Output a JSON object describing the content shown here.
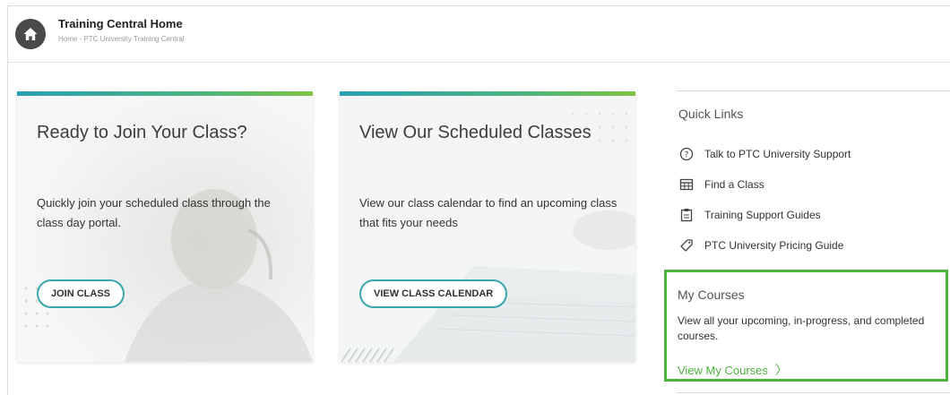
{
  "header": {
    "title": "Training Central Home",
    "breadcrumb": "Home - PTC University Training Central"
  },
  "cards": [
    {
      "title": "Ready to Join Your Class?",
      "description": "Quickly join your scheduled class through the class day portal.",
      "button_label": "JOIN CLASS"
    },
    {
      "title": "View Our Scheduled Classes",
      "description": "View our class calendar to find an upcoming class that fits your needs",
      "button_label": "VIEW CLASS CALENDAR"
    }
  ],
  "quick_links": {
    "title": "Quick Links",
    "items": [
      {
        "label": "Talk to PTC University Support",
        "icon": "question-circle-icon"
      },
      {
        "label": "Find a Class",
        "icon": "calendar-icon"
      },
      {
        "label": "Training Support Guides",
        "icon": "clipboard-icon"
      },
      {
        "label": "PTC University Pricing Guide",
        "icon": "price-tag-icon"
      }
    ]
  },
  "my_courses": {
    "title": "My Courses",
    "description": "View all your upcoming, in-progress, and completed courses.",
    "link_label": "View My Courses",
    "chevron": "〉"
  },
  "colors": {
    "accent_green": "#4db23e",
    "accent_teal": "#3aa6ae",
    "home_button": "#4a4a4a"
  }
}
